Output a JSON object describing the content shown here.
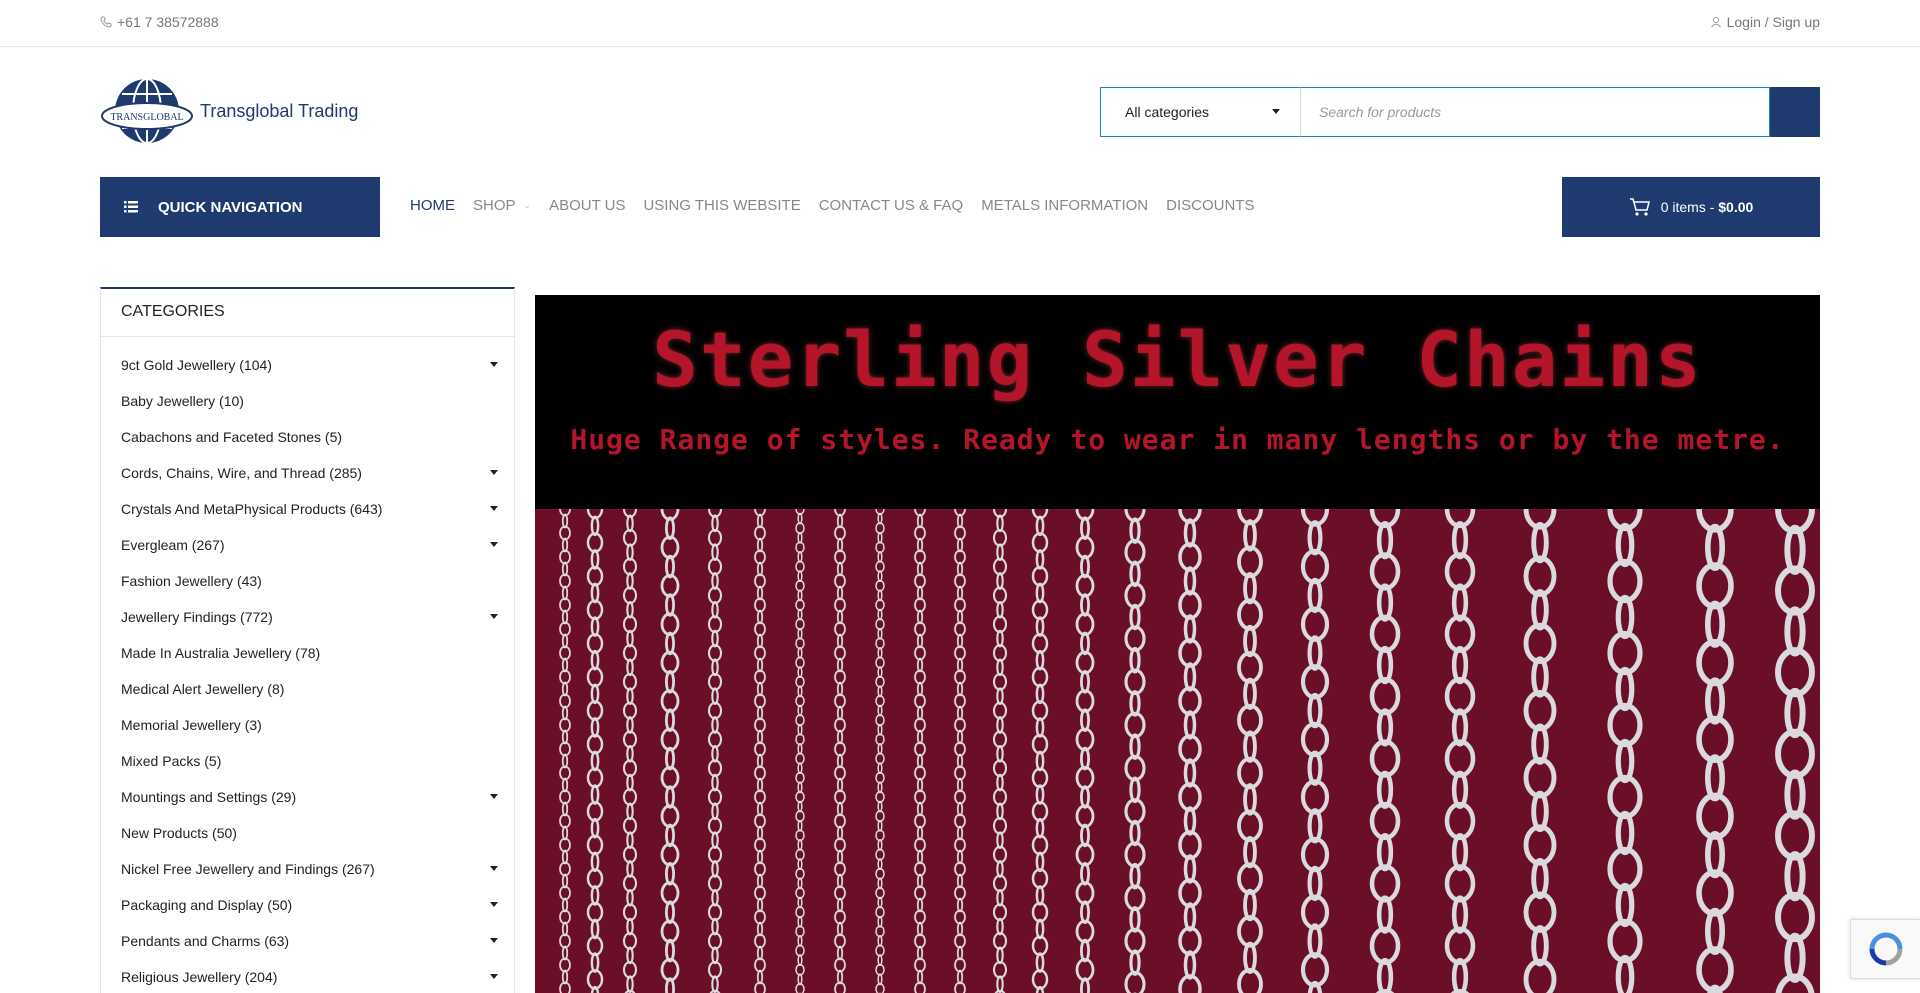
{
  "topbar": {
    "phone": "+61 7 38572888",
    "login": "Login / Sign up"
  },
  "logo": {
    "brand_text": "Transglobal Trading",
    "globe_text": "TRANSGLOBAL"
  },
  "search": {
    "category_selected": "All categories",
    "placeholder": "Search for products"
  },
  "quick_nav": {
    "label": "QUICK NAVIGATION"
  },
  "menu": {
    "items": [
      "HOME",
      "SHOP",
      "ABOUT US",
      "USING THIS WEBSITE",
      "CONTACT US & FAQ",
      "METALS INFORMATION",
      "DISCOUNTS"
    ]
  },
  "cart": {
    "items_text": "0 items - ",
    "total": "$0.00"
  },
  "categories": {
    "title": "CATEGORIES",
    "items": [
      {
        "label": "9ct Gold Jewellery (104)",
        "has_children": true
      },
      {
        "label": "Baby Jewellery (10)",
        "has_children": false
      },
      {
        "label": "Cabachons and Faceted Stones (5)",
        "has_children": false
      },
      {
        "label": "Cords, Chains, Wire, and Thread (285)",
        "has_children": true
      },
      {
        "label": "Crystals And MetaPhysical Products (643)",
        "has_children": true
      },
      {
        "label": "Evergleam (267)",
        "has_children": true
      },
      {
        "label": "Fashion Jewellery (43)",
        "has_children": false
      },
      {
        "label": "Jewellery Findings (772)",
        "has_children": true
      },
      {
        "label": "Made In Australia Jewellery (78)",
        "has_children": false
      },
      {
        "label": "Medical Alert Jewellery (8)",
        "has_children": false
      },
      {
        "label": "Memorial Jewellery (3)",
        "has_children": false
      },
      {
        "label": "Mixed Packs (5)",
        "has_children": false
      },
      {
        "label": "Mountings and Settings (29)",
        "has_children": true
      },
      {
        "label": "New Products (50)",
        "has_children": false
      },
      {
        "label": "Nickel Free Jewellery and Findings (267)",
        "has_children": true
      },
      {
        "label": "Packaging and Display (50)",
        "has_children": true
      },
      {
        "label": "Pendants and Charms (63)",
        "has_children": true
      },
      {
        "label": "Religious Jewellery (204)",
        "has_children": true
      }
    ]
  },
  "banner": {
    "title": "Sterling Silver Chains",
    "subtitle": "Huge Range of styles. Ready to wear in many lengths or by the metre."
  },
  "colors": {
    "brand_navy": "#1e3a6e",
    "search_border": "#1f8aa5",
    "banner_red": "#b5152b",
    "banner_velvet": "#6b0f29"
  }
}
